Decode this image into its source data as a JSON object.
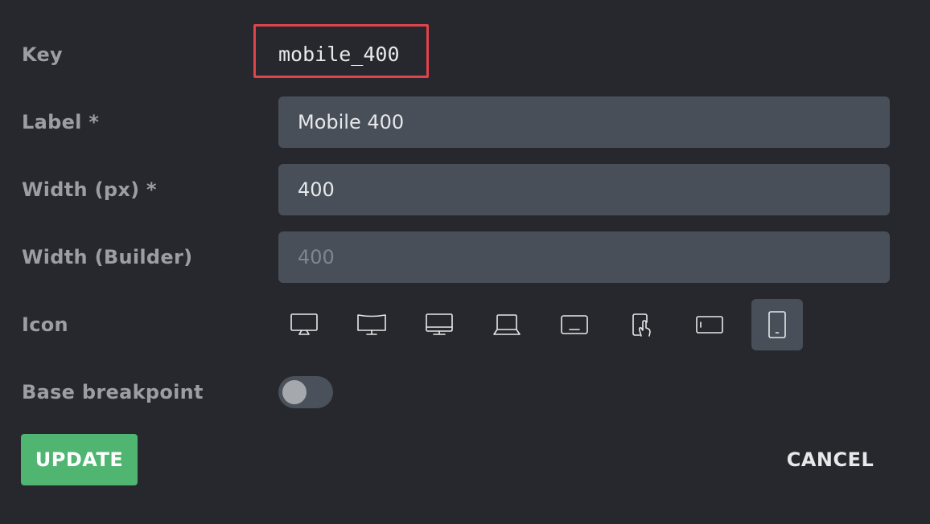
{
  "form": {
    "key": {
      "label": "Key",
      "value": "mobile_400"
    },
    "label_field": {
      "label": "Label *",
      "value": "Mobile 400"
    },
    "width_px": {
      "label": "Width (px) *",
      "value": "400"
    },
    "width_builder": {
      "label": "Width (Builder)",
      "placeholder": "400"
    },
    "icon": {
      "label": "Icon",
      "options": [
        {
          "name": "desktop-stand-icon"
        },
        {
          "name": "wide-monitor-icon"
        },
        {
          "name": "desktop-icon"
        },
        {
          "name": "laptop-icon"
        },
        {
          "name": "tablet-landscape-icon"
        },
        {
          "name": "tablet-touch-icon"
        },
        {
          "name": "mobile-landscape-icon"
        },
        {
          "name": "mobile-portrait-icon"
        }
      ],
      "selected_index": 7
    },
    "base_breakpoint": {
      "label": "Base breakpoint",
      "enabled": false
    }
  },
  "actions": {
    "update_label": "UPDATE",
    "cancel_label": "CANCEL"
  },
  "colors": {
    "background": "#26282d",
    "input_background": "#484f59",
    "label_text": "#9b9ea3",
    "update_button": "#4fb570",
    "highlight_border": "#e0434c"
  }
}
